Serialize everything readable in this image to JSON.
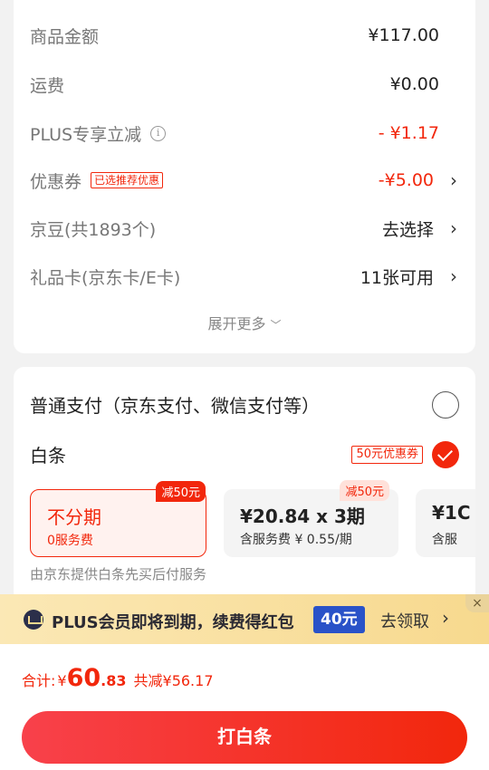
{
  "summary": {
    "rows": [
      {
        "label": "商品金额",
        "value": "¥117.00"
      },
      {
        "label": "运费",
        "value": "¥0.00"
      },
      {
        "label": "PLUS专享立减",
        "value": "- ¥1.17",
        "info_icon": "i"
      },
      {
        "label": "优惠券",
        "tag": "已选推荐优惠",
        "value": "-¥5.00"
      },
      {
        "label": "京豆(共1893个)",
        "value": "去选择"
      },
      {
        "label": "礼品卡(京东卡/E卡)",
        "value": "11张可用"
      }
    ],
    "more": "展开更多"
  },
  "payment": {
    "normal_label": "普通支付（京东支付、微信支付等）",
    "baitiao_label": "白条",
    "coupon_tag": "50元优惠券",
    "plans": [
      {
        "main": "不分期",
        "sub": "0服务费",
        "badge": "减50元"
      },
      {
        "main": "¥20.84 x 3期",
        "sub": "含服务费 ¥ 0.55/期",
        "badge": "减50元"
      },
      {
        "main": "¥1C",
        "sub": "含服"
      }
    ],
    "provider": "由京东提供白条先买后付服务"
  },
  "plus_banner": {
    "text": "PLUS会员即将到期，续费得红包",
    "amount": "40元",
    "claim": "去领取",
    "close": "×"
  },
  "footer": {
    "total_label": "合计:",
    "currency": "¥",
    "total_int": "60",
    "total_dec": ".83",
    "discount": "共减¥56.17",
    "cta": "打白条"
  },
  "colors": {
    "accent": "#f2270c",
    "plus_blue": "#2952c8",
    "banner_gold": "#f7d98e"
  }
}
